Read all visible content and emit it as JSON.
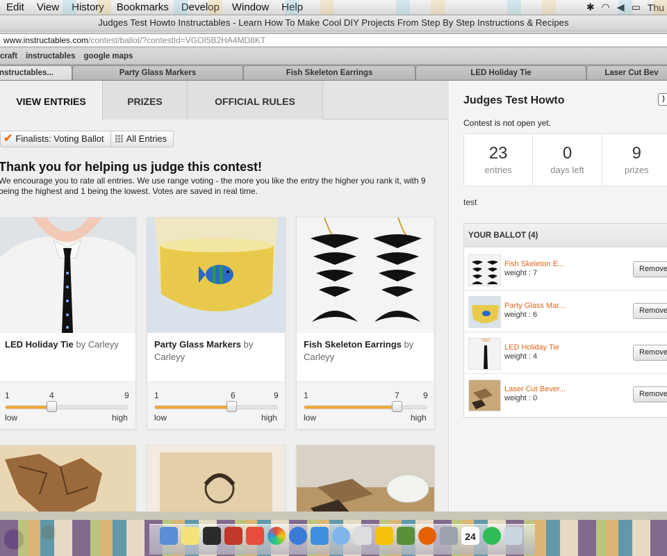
{
  "menubar": {
    "items": [
      "Edit",
      "View",
      "History",
      "Bookmarks",
      "Develop",
      "Window",
      "Help"
    ],
    "clock": "Thu"
  },
  "browser": {
    "window_title": "Judges Test Howto Instructables - Learn How To Make Cool DIY Projects From Step By Step Instructions & Recipes",
    "url_host": "www.instructables.com",
    "url_path": "/contest/ballot/?contestId=VGOI5B2HA4MD8KT",
    "bookmarks": [
      "craft",
      "instructables",
      "google maps"
    ],
    "tabs": [
      "nstructables...",
      "Party Glass Markers",
      "Fish Skeleton Earrings",
      "LED Holiday Tie",
      "Laser Cut Bev"
    ]
  },
  "contest_tabs": [
    "VIEW ENTRIES",
    "PRIZES",
    "OFFICIAL RULES"
  ],
  "filters": {
    "finalists_label": "Finalists: Voting Ballot",
    "all_entries_label": "All Entries"
  },
  "intro": {
    "heading": "Thank you for helping us judge this contest!",
    "text": "We encourage you to rate all entries. We use range voting - the more you like the entry the higher you rank it, with 9 being the highest and 1 being the lowest. Votes are saved in real time."
  },
  "entries": [
    {
      "title": "LED Holiday Tie",
      "by": " by Carleyy",
      "min": "1",
      "value": "4",
      "max": "9",
      "low": "low",
      "high": "high",
      "rating_fraction": 0.375
    },
    {
      "title": "Party Glass Markers",
      "by": " by Carleyy",
      "min": "1",
      "value": "6",
      "max": "9",
      "low": "low",
      "high": "high",
      "rating_fraction": 0.625
    },
    {
      "title": "Fish Skeleton Earrings",
      "by": " by Carleyy",
      "min": "1",
      "value": "7",
      "max": "9",
      "low": "low",
      "high": "high",
      "rating_fraction": 0.75
    }
  ],
  "sidebar": {
    "title": "Judges Test Howto",
    "status": "Contest is not open yet.",
    "stats": [
      {
        "num": "23",
        "cap": "entries"
      },
      {
        "num": "0",
        "cap": "days left"
      },
      {
        "num": "9",
        "cap": "prizes"
      }
    ],
    "description": "test",
    "ballot_heading": "YOUR BALLOT (4)",
    "ballot": [
      {
        "name": "Fish Skeleton E...",
        "weight": "weight : 7",
        "remove": "Remove"
      },
      {
        "name": "Party Glass Mar...",
        "weight": "weight : 6",
        "remove": "Remove"
      },
      {
        "name": "LED Holiday Tie",
        "weight": "weight : 4",
        "remove": "Remove"
      },
      {
        "name": "Laser Cut Bever...",
        "weight": "weight : 0",
        "remove": "Remove"
      }
    ]
  },
  "dock_calendar_day": "24",
  "colors": {
    "accent_orange": "#e0661c",
    "slider_fill": "#f0a838"
  }
}
